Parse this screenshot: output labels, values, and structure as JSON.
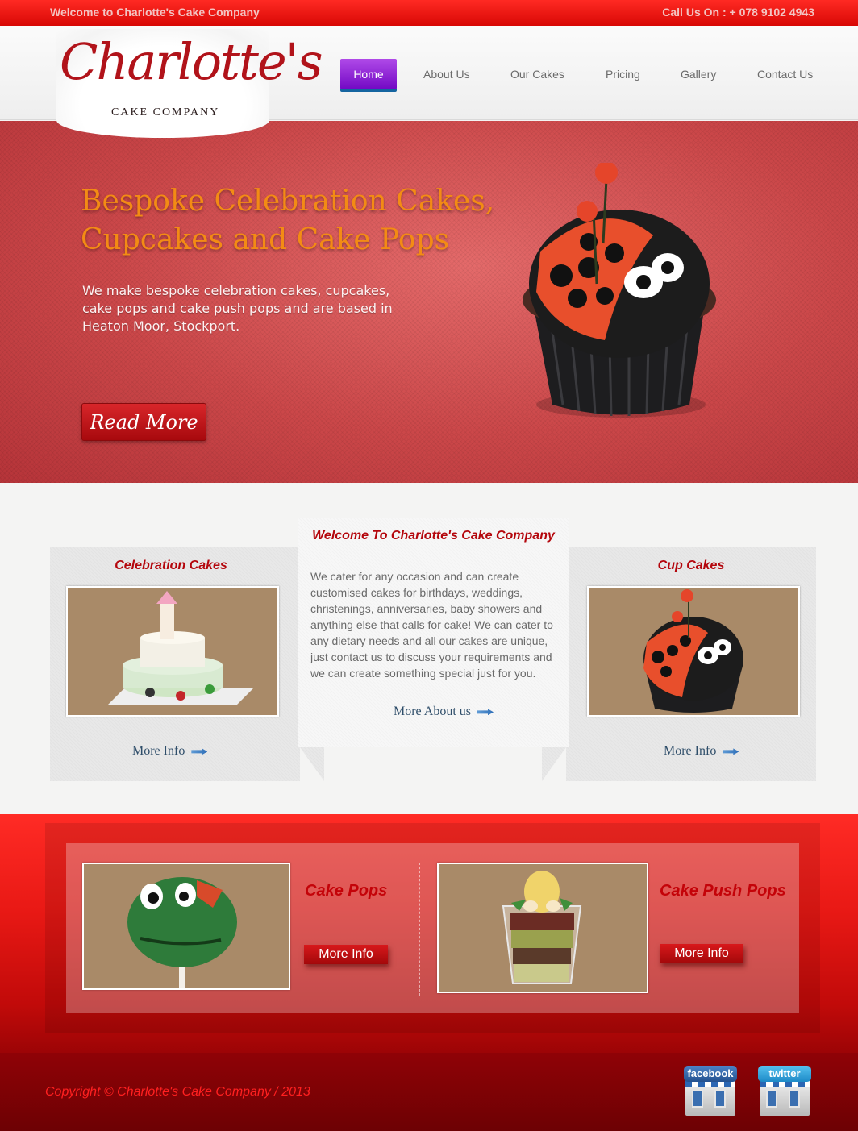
{
  "topbar": {
    "welcome": "Welcome to Charlotte's Cake Company",
    "phone": "Call Us On : + 078 9102 4943"
  },
  "logo": {
    "script": "Charlotte's",
    "subtitle": "Cake Company"
  },
  "nav": {
    "items": [
      {
        "label": "Home",
        "active": true
      },
      {
        "label": "About Us"
      },
      {
        "label": "Our Cakes"
      },
      {
        "label": "Pricing"
      },
      {
        "label": "Gallery"
      },
      {
        "label": "Contact Us"
      }
    ]
  },
  "hero": {
    "title": "Bespoke Celebration Cakes, Cupcakes and Cake Pops",
    "text": "We make bespoke celebration cakes, cupcakes, cake pops and cake push pops and are based in Heaton Moor, Stockport.",
    "button": "Read More"
  },
  "left_panel": {
    "title": "Celebration Cakes",
    "link": "More Info"
  },
  "center_panel": {
    "title": "Welcome To Charlotte's Cake Company",
    "text": "We cater for any occasion and can create customised cakes for birthdays, weddings, christenings, anniversaries, baby showers and anything else that calls for cake! We can cater to any dietary needs and all our cakes are unique, just contact us to discuss your requirements and we can create something special just for you.",
    "link": "More About us"
  },
  "right_panel": {
    "title": "Cup Cakes",
    "link": "More Info"
  },
  "band": {
    "left": {
      "title": "Cake Pops",
      "button": "More Info"
    },
    "right": {
      "title": "Cake Push Pops",
      "button": "More Info"
    }
  },
  "footer": {
    "copyright": "Copyright © Charlotte's Cake Company / 2013",
    "social": [
      {
        "label": "facebook",
        "icon": "facebook-icon"
      },
      {
        "label": "twitter",
        "icon": "twitter-icon"
      }
    ]
  },
  "colors": {
    "accent_red": "#b4060c",
    "nav_active": "#7208c4",
    "hero_title": "#f38b14"
  }
}
